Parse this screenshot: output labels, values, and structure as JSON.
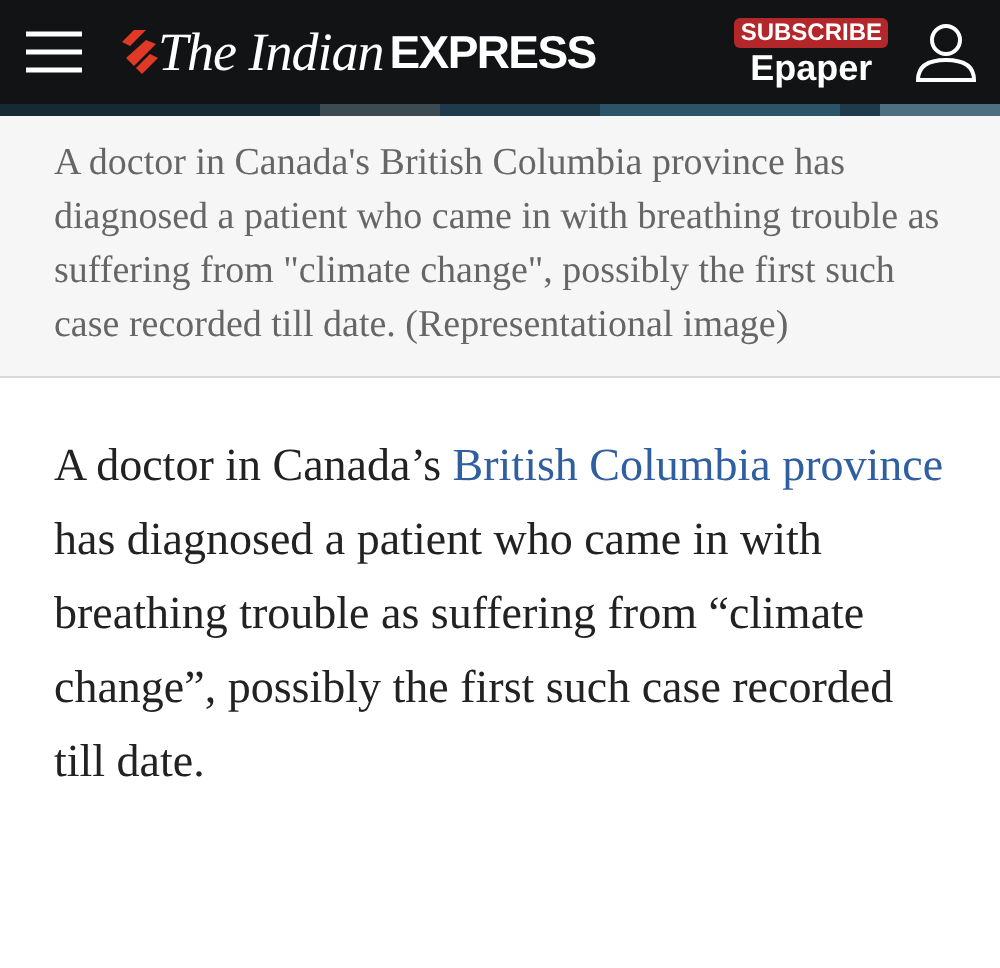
{
  "header": {
    "logo_serif": "The Indian",
    "logo_bold": "EXPRESS",
    "subscribe": "SUBSCRIBE",
    "epaper": "Epaper"
  },
  "caption": "A doctor in Canada's British Columbia province has diagnosed a patient who came in with breathing trouble as suffering from \"climate change\", possibly the first such case recorded till date. (Representational image)",
  "article": {
    "before": "A doctor in Canada’s ",
    "link": "British Columbia province",
    "after": " has diagnosed a patient who came in with breathing trouble as suffering from “climate change”, possibly the first such case recorded till date."
  }
}
